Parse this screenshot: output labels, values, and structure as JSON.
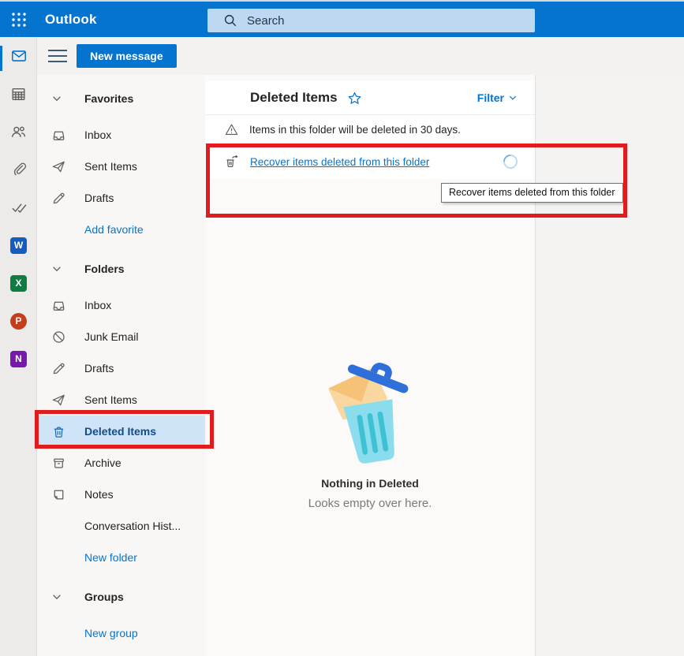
{
  "colors": {
    "topbar": "#0574ce",
    "accent": "#0574ce",
    "search_bg": "#bdd8f0",
    "selected_row_bg": "#cfe4f7",
    "annotation_red": "#e11c1f"
  },
  "topbar": {
    "app_name": "Outlook",
    "search_placeholder": "Search"
  },
  "toolbar": {
    "new_message_label": "New message"
  },
  "rail": {
    "word_letter": "W",
    "excel_letter": "X",
    "powerpoint_letter": "P",
    "onenote_letter": "N"
  },
  "sidebar": {
    "sections": [
      {
        "label": "Favorites",
        "items": [
          {
            "label": "Inbox"
          },
          {
            "label": "Sent Items"
          },
          {
            "label": "Drafts"
          },
          {
            "label": "Add favorite"
          }
        ]
      },
      {
        "label": "Folders",
        "items": [
          {
            "label": "Inbox"
          },
          {
            "label": "Junk Email"
          },
          {
            "label": "Drafts"
          },
          {
            "label": "Sent Items"
          },
          {
            "label": "Deleted Items"
          },
          {
            "label": "Archive"
          },
          {
            "label": "Notes"
          },
          {
            "label": "Conversation Hist..."
          },
          {
            "label": "New folder"
          }
        ]
      },
      {
        "label": "Groups",
        "items": [
          {
            "label": "New group"
          }
        ]
      }
    ]
  },
  "main": {
    "title": "Deleted Items",
    "filter_label": "Filter",
    "info_message": "Items in this folder will be deleted in 30 days.",
    "recover_link_label": "Recover items deleted from this folder",
    "tooltip_text": "Recover items deleted from this folder",
    "empty_state": {
      "title": "Nothing in Deleted",
      "subtitle": "Looks empty over here."
    }
  }
}
